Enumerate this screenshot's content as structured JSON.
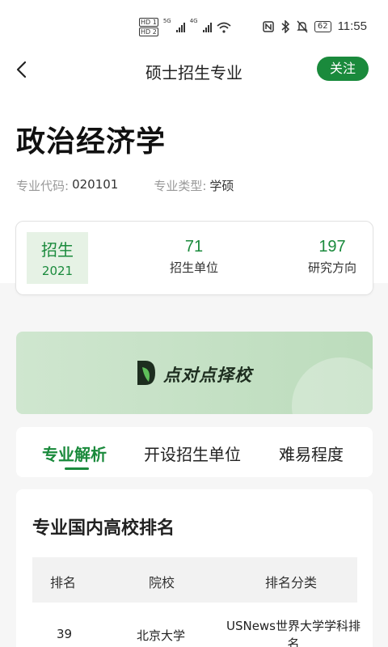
{
  "status": {
    "hd1": "HD 1",
    "hd2": "HD 2",
    "net1": "5G",
    "net2": "4G",
    "battery": "62",
    "time": "11:55"
  },
  "nav": {
    "title": "硕士招生专业",
    "follow_label": "关注"
  },
  "major": {
    "name": "政治经济学",
    "code_label": "专业代码:",
    "code": "020101",
    "type_label": "专业类型:",
    "type": "学硕"
  },
  "stats": {
    "active_label": "招生",
    "active_year": "2021",
    "units_count": "71",
    "units_label": "招生单位",
    "directions_count": "197",
    "directions_label": "研究方向"
  },
  "banner": {
    "text": "点对点择校"
  },
  "tabs": [
    {
      "label": "专业解析"
    },
    {
      "label": "开设招生单位"
    },
    {
      "label": "难易程度"
    }
  ],
  "ranking": {
    "title": "专业国内高校排名",
    "headers": [
      "排名",
      "院校",
      "排名分类"
    ],
    "rows": [
      {
        "rank": "39",
        "school": "北京大学",
        "category": "USNews世界大学学科排名"
      }
    ]
  },
  "colors": {
    "accent": "#1a8a3c",
    "accent_light": "#e6f2e5"
  }
}
